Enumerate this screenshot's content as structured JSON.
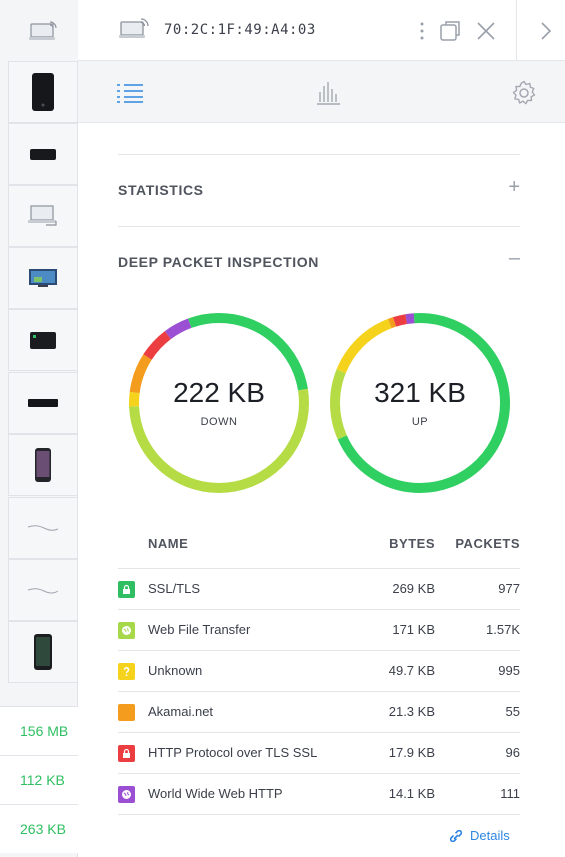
{
  "header": {
    "title": "70:2C:1F:49:A4:03",
    "more_icon": "vertical-dots-icon",
    "popout_icon": "popout-icon",
    "close_icon": "close-icon",
    "next_icon": "chevron-right-icon"
  },
  "tabs": [
    {
      "name": "overview",
      "icon": "list-icon",
      "active": true
    },
    {
      "name": "statistics",
      "icon": "bar-chart-icon",
      "active": false
    },
    {
      "name": "settings",
      "icon": "gear-icon",
      "active": false
    }
  ],
  "sidebar": {
    "devices": [
      {
        "icon": "laptop-wifi-icon"
      },
      {
        "icon": "tower-device-icon"
      },
      {
        "icon": "router-device-icon"
      },
      {
        "icon": "laptop-icon"
      },
      {
        "icon": "tv-icon"
      },
      {
        "icon": "nas-device-icon"
      },
      {
        "icon": "set-top-box-icon"
      },
      {
        "icon": "phone-icon"
      },
      {
        "icon": "cable-icon"
      },
      {
        "icon": "cable-icon"
      },
      {
        "icon": "iphone-icon"
      }
    ],
    "sizes": [
      "156 MB",
      "112 KB",
      "263 KB"
    ]
  },
  "sections": {
    "statistics": {
      "title": "STATISTICS",
      "toggle": "+"
    },
    "dpi": {
      "title": "DEEP PACKET INSPECTION",
      "toggle": "–"
    }
  },
  "donuts": {
    "down": {
      "value": "222 KB",
      "label": "DOWN"
    },
    "up": {
      "value": "321 KB",
      "label": "UP"
    }
  },
  "table": {
    "headers": {
      "name": "NAME",
      "bytes": "BYTES",
      "packets": "PACKETS"
    },
    "rows": [
      {
        "name": "SSL/TLS",
        "bytes": "269 KB",
        "packets": "977",
        "color": "#2fbf62",
        "icon": "lock-icon"
      },
      {
        "name": "Web File Transfer",
        "bytes": "171 KB",
        "packets": "1.57K",
        "color": "#a6d84a",
        "icon": "globe-icon"
      },
      {
        "name": "Unknown",
        "bytes": "49.7 KB",
        "packets": "995",
        "color": "#f5d31c",
        "icon": "question-icon"
      },
      {
        "name": "Akamai.net",
        "bytes": "21.3 KB",
        "packets": "55",
        "color": "#f39c1d",
        "icon": "square-icon"
      },
      {
        "name": "HTTP Protocol over TLS SSL",
        "bytes": "17.9 KB",
        "packets": "96",
        "color": "#ec3e40",
        "icon": "lock-icon"
      },
      {
        "name": "World Wide Web HTTP",
        "bytes": "14.1 KB",
        "packets": "111",
        "color": "#9b4fd2",
        "icon": "globe-icon"
      }
    ]
  },
  "details_link": "Details",
  "colors": {
    "ssl": "#2fbf62",
    "web_file": "#b5dc45",
    "unknown": "#f5d31c",
    "akamai": "#f39c1d",
    "http_tls": "#ec3e40",
    "www": "#9b4fd2",
    "accent": "#2f86e0"
  }
}
